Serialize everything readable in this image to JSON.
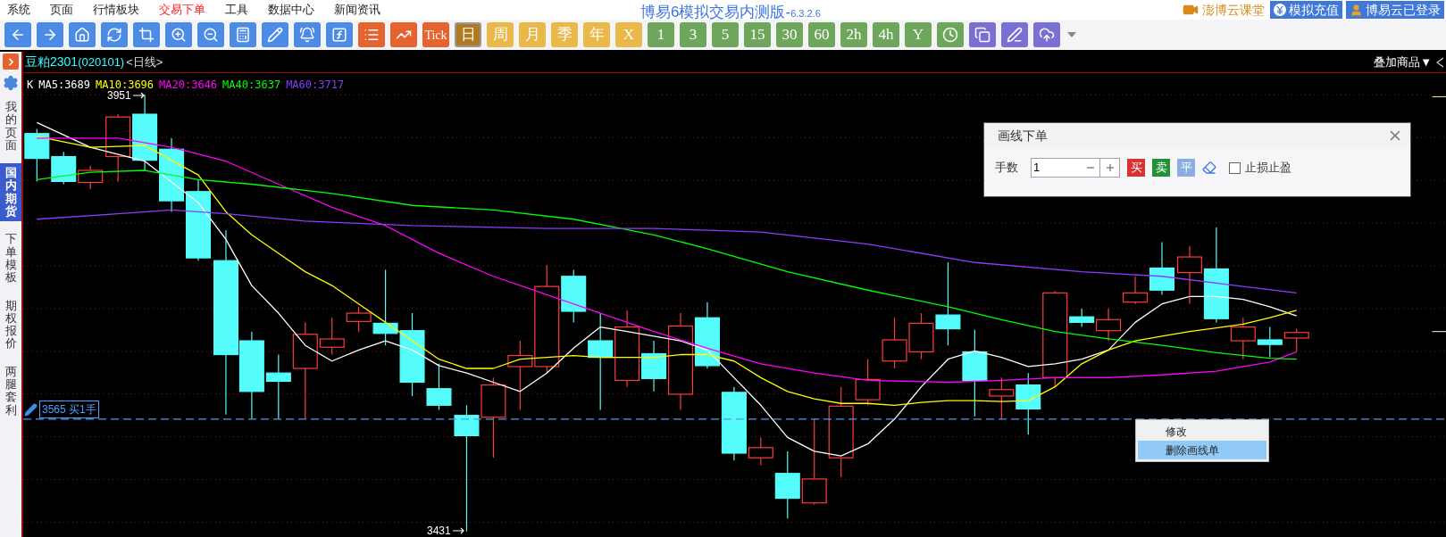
{
  "menu": [
    {
      "label": "系统",
      "selected": false
    },
    {
      "label": "页面",
      "selected": false
    },
    {
      "label": "行情板块",
      "selected": false
    },
    {
      "label": "交易下单",
      "selected": true
    },
    {
      "label": "工具",
      "selected": false
    },
    {
      "label": "数据中心",
      "selected": false
    },
    {
      "label": "新闻资讯",
      "selected": false
    }
  ],
  "app_title": "博易6模拟交易内测版-",
  "version": "6.3.2.6",
  "header_links": [
    {
      "label": "澎博云课堂",
      "kind": "video"
    },
    {
      "label": "模拟充值",
      "kind": "yuan"
    },
    {
      "label": "博易云已登录",
      "kind": "user"
    }
  ],
  "periods": [
    {
      "label": "Tick",
      "kind": "tick",
      "selected": false
    },
    {
      "label": "日",
      "kind": "gold",
      "selected": true
    },
    {
      "label": "周",
      "kind": "gold",
      "selected": false
    },
    {
      "label": "月",
      "kind": "gold",
      "selected": false
    },
    {
      "label": "季",
      "kind": "gold",
      "selected": false
    },
    {
      "label": "年",
      "kind": "gold",
      "selected": false
    },
    {
      "label": "X",
      "kind": "gold",
      "selected": false
    },
    {
      "label": "1",
      "kind": "green",
      "selected": false
    },
    {
      "label": "3",
      "kind": "green",
      "selected": false
    },
    {
      "label": "5",
      "kind": "green",
      "selected": false
    },
    {
      "label": "15",
      "kind": "green",
      "selected": false
    },
    {
      "label": "30",
      "kind": "green",
      "selected": false
    },
    {
      "label": "60",
      "kind": "green",
      "selected": false
    },
    {
      "label": "2h",
      "kind": "green",
      "selected": false
    },
    {
      "label": "4h",
      "kind": "green",
      "selected": false
    },
    {
      "label": "Y",
      "kind": "green",
      "selected": false
    }
  ],
  "sidebar": [
    {
      "label": "我的页面",
      "selected": false
    },
    {
      "label": "国内期货",
      "selected": true
    },
    {
      "label": "下单模板",
      "selected": false
    },
    {
      "label": "期权报价",
      "selected": false
    },
    {
      "label": "两腿套利",
      "selected": false
    }
  ],
  "chart": {
    "symbol": "豆粕2301",
    "code": "(020101)",
    "period": "<日线>",
    "overlay_button": "叠加商品▼",
    "indicators": [
      {
        "label": "K",
        "color": "#ffffff"
      },
      {
        "label": "MA5:3689",
        "color": "#ffffff"
      },
      {
        "label": "MA10:3696",
        "color": "#ffff00"
      },
      {
        "label": "MA20:3646",
        "color": "#ff00ff"
      },
      {
        "label": "MA40:3637",
        "color": "#00ff00"
      },
      {
        "label": "MA60:3717",
        "color": "#8a3cff"
      }
    ],
    "high_label": "3951",
    "low_label": "3431",
    "order_label": "3565 买1手"
  },
  "dialog": {
    "title": "画线下单",
    "lots_label": "手数",
    "lots_value": "1",
    "buttons": [
      {
        "label": "买",
        "kind": "buy"
      },
      {
        "label": "卖",
        "kind": "sell"
      },
      {
        "label": "平",
        "kind": "close"
      }
    ],
    "stop": {
      "label": "止损止盈",
      "checked": false
    }
  },
  "context_menu": [
    {
      "label": "修改",
      "selected": false
    },
    {
      "label": "删除画线单",
      "selected": true
    }
  ]
}
